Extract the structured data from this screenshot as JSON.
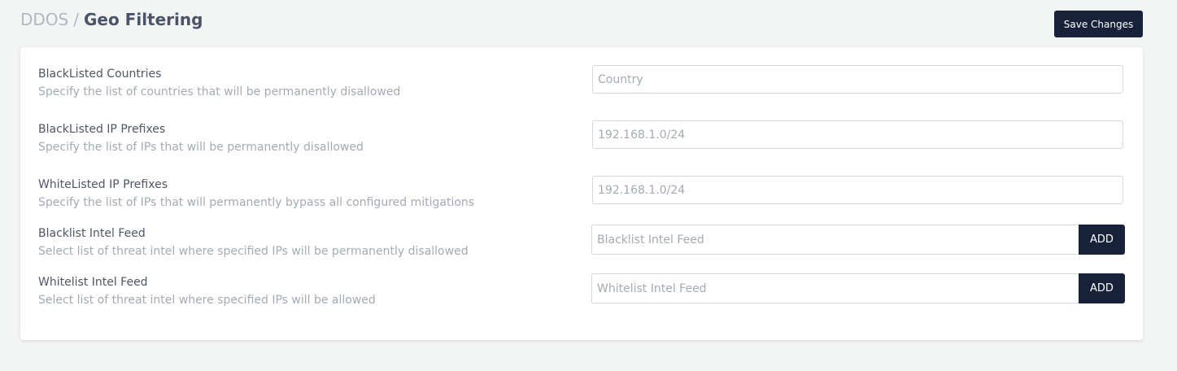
{
  "breadcrumb": {
    "parent": "DDOS",
    "separator": "/",
    "current": "Geo Filtering"
  },
  "header": {
    "save_label": "Save Changes"
  },
  "settings": {
    "blacklisted_countries": {
      "label": "BlackListed Countries",
      "description": "Specify the list of countries that will be permanently disallowed",
      "placeholder": "Country"
    },
    "blacklisted_ip_prefixes": {
      "label": "BlackListed IP Prefixes",
      "description": "Specify the list of IPs that will be permanently disallowed",
      "placeholder": "192.168.1.0/24"
    },
    "whitelisted_ip_prefixes": {
      "label": "WhiteListed IP Prefixes",
      "description": "Specify the list of IPs that will permanently bypass all configured mitigations",
      "placeholder": "192.168.1.0/24"
    },
    "blacklist_intel_feed": {
      "label": "Blacklist Intel Feed",
      "description": "Select list of threat intel where specified IPs will be permanently disallowed",
      "placeholder": "Blacklist Intel Feed",
      "button_label": "ADD"
    },
    "whitelist_intel_feed": {
      "label": "Whitelist Intel Feed",
      "description": "Select list of threat intel where specified IPs will be allowed",
      "placeholder": "Whitelist Intel Feed",
      "button_label": "ADD"
    }
  },
  "colors": {
    "primary_button": "#18213a",
    "page_background": "#f3f4f4",
    "title_text": "#4a5468",
    "muted_text": "#a4aab3"
  }
}
